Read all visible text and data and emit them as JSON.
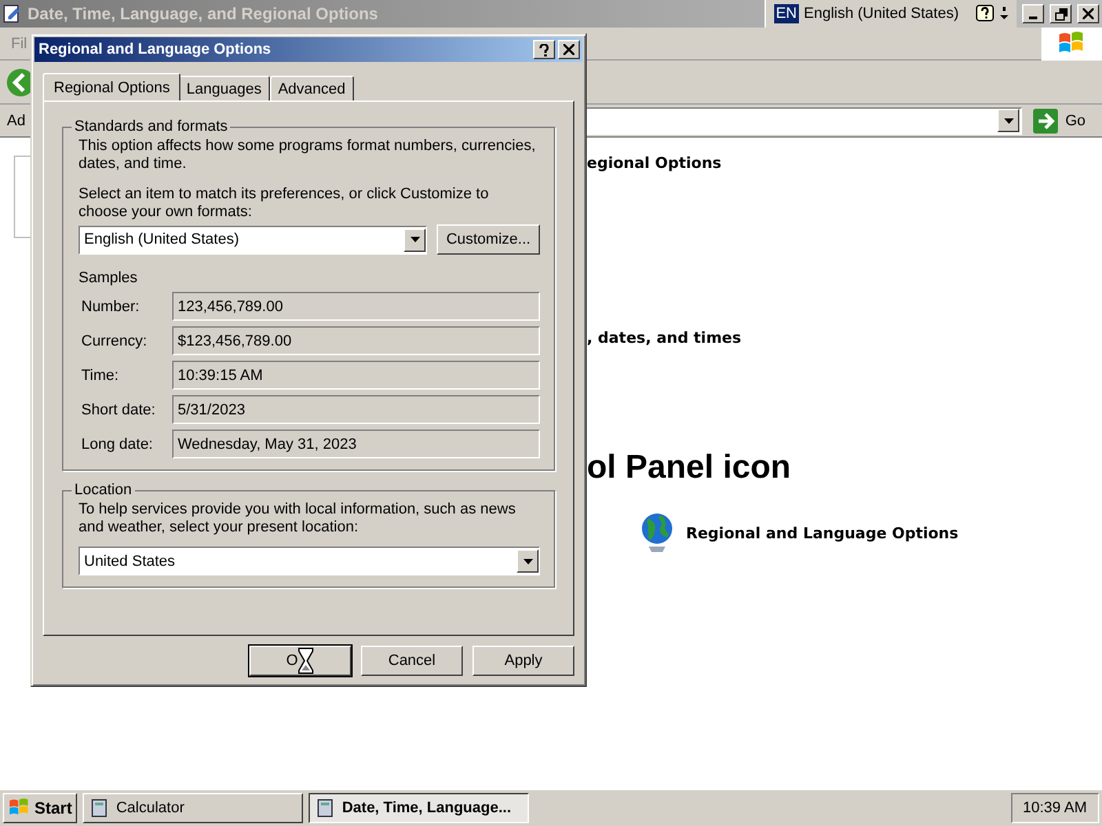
{
  "main_window": {
    "title": "Date, Time, Language, and Regional Options",
    "menu": [
      "Fil"
    ],
    "address_label": "Ad",
    "go": "Go",
    "content": [
      {
        "kind": "section_title",
        "text": "egional Options"
      },
      {
        "kind": "section_title",
        "text": ", dates, and times"
      },
      {
        "kind": "heading",
        "text": "ol Panel icon"
      },
      {
        "kind": "task_link",
        "text": "Regional and Language Options"
      }
    ]
  },
  "language_bar": {
    "code": "EN",
    "language": "English (United States)"
  },
  "dialog": {
    "title": "Regional and Language Options",
    "tabs": [
      {
        "label": "Regional Options",
        "selected": true
      },
      {
        "label": "Languages",
        "selected": false
      },
      {
        "label": "Advanced",
        "selected": false
      }
    ],
    "standards": {
      "title": "Standards and formats",
      "description": "This option affects how some programs format numbers, currencies, dates, and time.",
      "prompt": "Select an item to match its preferences, or click Customize to choose your own formats:",
      "format_value": "English (United States)",
      "customize": "Customize...",
      "samples_title": "Samples",
      "samples": [
        {
          "label": "Number:",
          "value": "123,456,789.00"
        },
        {
          "label": "Currency:",
          "value": "$123,456,789.00"
        },
        {
          "label": "Time:",
          "value": "10:39:15 AM"
        },
        {
          "label": "Short date:",
          "value": "5/31/2023"
        },
        {
          "label": "Long date:",
          "value": "Wednesday, May 31, 2023"
        }
      ]
    },
    "location": {
      "title": "Location",
      "description": "To help services provide you with local information, such as news and weather, select your present location:",
      "value": "United States"
    },
    "buttons": [
      {
        "label": "O",
        "default": true
      },
      {
        "label": "Cancel",
        "default": false
      },
      {
        "label": "Apply",
        "default": false
      }
    ]
  },
  "taskbar": {
    "start": "Start",
    "tasks": [
      {
        "label": "Calculator",
        "selected": false
      },
      {
        "label": "Date, Time, Language...",
        "selected": true
      }
    ],
    "clock": "10:39 AM"
  }
}
